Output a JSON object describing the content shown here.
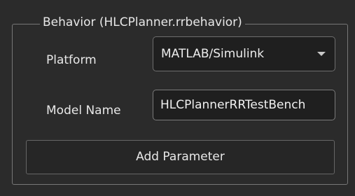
{
  "group": {
    "title": "Behavior (HLCPlanner.rrbehavior)"
  },
  "platform": {
    "label": "Platform",
    "selected": "MATLAB/Simulink",
    "icon": "chevron-down-icon"
  },
  "model_name": {
    "label": "Model Name",
    "value": "HLCPlannerRRTestBench"
  },
  "actions": {
    "add_parameter_label": "Add Parameter"
  },
  "colors": {
    "background": "#2b2b2b",
    "field_background": "#1f1f1f",
    "border": "#777777",
    "text": "#e8e8e8"
  }
}
